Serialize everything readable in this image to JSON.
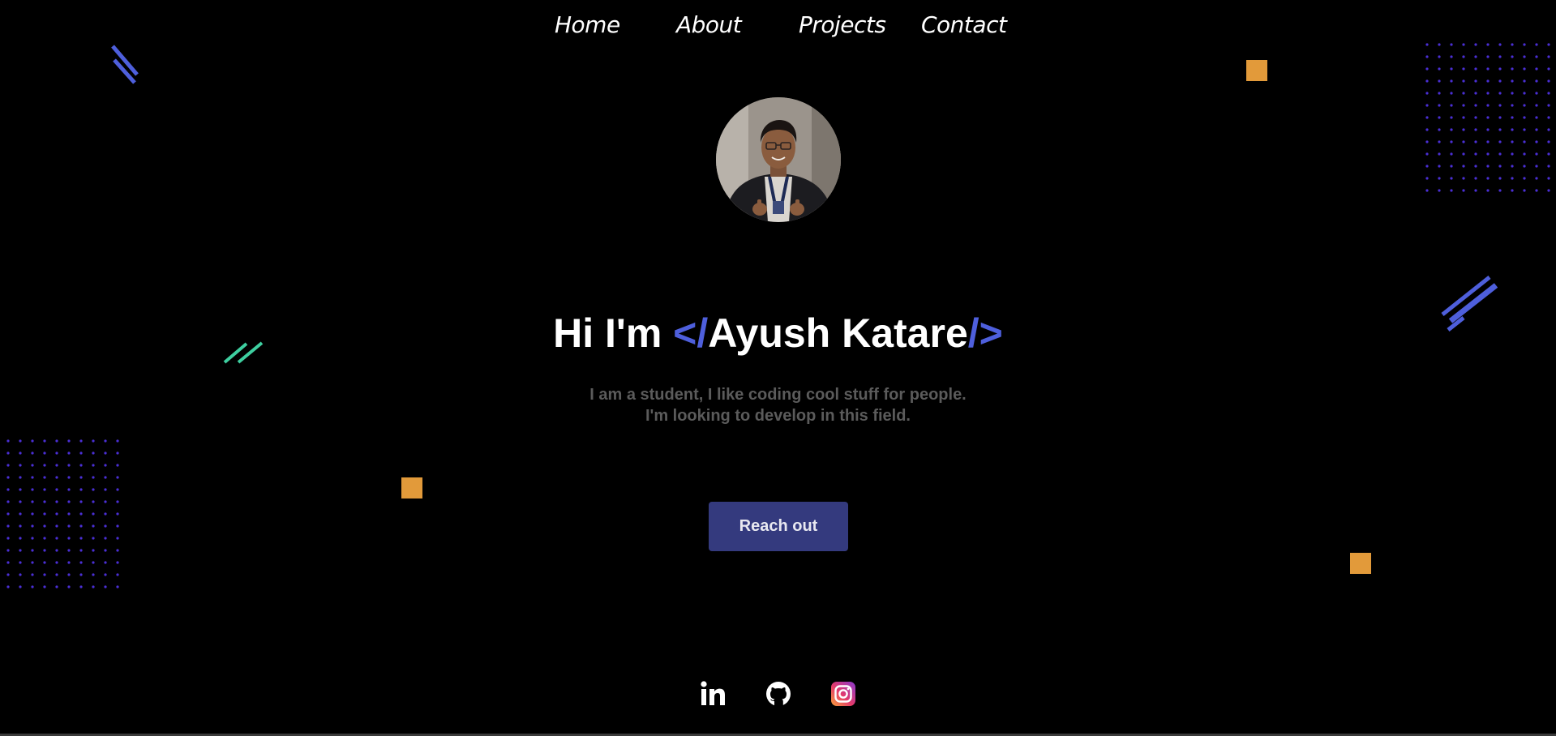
{
  "nav": {
    "home": "Home",
    "about": "About",
    "projects": "Projects",
    "contact": "Contact"
  },
  "hero": {
    "greeting": "Hi I'm ",
    "open_tag": "</",
    "name": "Ayush Katare",
    "close_tag": "/>",
    "tagline_line1": "I am a student, I like coding cool stuff for people.",
    "tagline_line2": "I'm looking to develop in this field.",
    "cta_label": "Reach out"
  },
  "social": [
    "linkedin-icon",
    "github-icon",
    "instagram-icon"
  ],
  "colors": {
    "background": "#000000",
    "accent_blue": "#4e5fdc",
    "button": "#343a7e",
    "square_orange": "#e29a3a",
    "teal_lines": "#3ecfa0",
    "dot_purple": "#4a2fd6",
    "tagline_gray": "#5b5b5b"
  }
}
